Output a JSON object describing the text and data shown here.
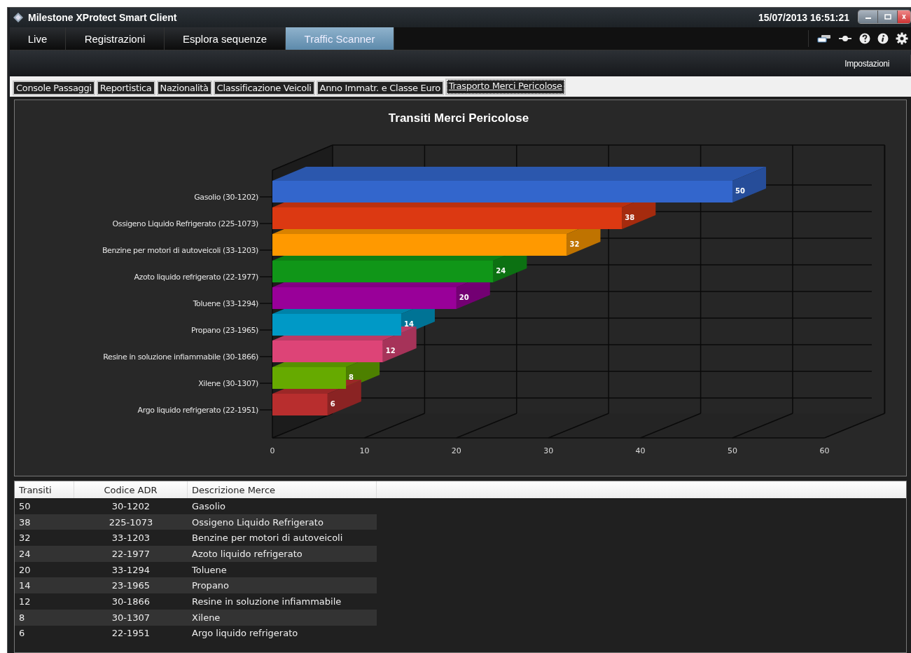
{
  "window": {
    "title": "Milestone XProtect Smart Client",
    "datetime": "15/07/2013 16:51:21"
  },
  "main_tabs": [
    {
      "label": "Live",
      "selected": false
    },
    {
      "label": "Registrazioni",
      "selected": false
    },
    {
      "label": "Esplora sequenze",
      "selected": false
    },
    {
      "label": "Traffic Scanner",
      "selected": true
    }
  ],
  "toolbar": {
    "settings_label": "Impostazioni"
  },
  "sub_tabs": [
    {
      "label": "Console Passaggi",
      "selected": false
    },
    {
      "label": "Reportistica",
      "selected": false
    },
    {
      "label": "Nazionalità",
      "selected": false
    },
    {
      "label": "Classificazione Veicoli",
      "selected": false
    },
    {
      "label": "Anno Immatr. e Classe Euro",
      "selected": false
    },
    {
      "label": "Trasporto Merci Pericolose",
      "selected": true
    }
  ],
  "chart": {
    "chart_data": {
      "type": "bar",
      "orientation": "horizontal",
      "title": "Transiti Merci Pericolose",
      "categories": [
        "Gasolio (30-1202)",
        "Ossigeno Liquido Refrigerato (225-1073)",
        "Benzine per motori di autoveicoli (33-1203)",
        "Azoto liquido refrigerato (22-1977)",
        "Toluene (33-1294)",
        "Propano (23-1965)",
        "Resine in soluzione infiammabile (30-1866)",
        "Xilene (30-1307)",
        "Argo liquido refrigerato (22-1951)"
      ],
      "values": [
        50,
        38,
        32,
        24,
        20,
        14,
        12,
        8,
        6
      ],
      "xlim": [
        0,
        60
      ],
      "xticks": [
        0,
        10,
        20,
        30,
        40,
        50,
        60
      ],
      "data_labels": true
    }
  },
  "table": {
    "columns": [
      "Transiti",
      "Codice ADR",
      "Descrizione Merce"
    ],
    "rows": [
      [
        "50",
        "30-1202",
        "Gasolio"
      ],
      [
        "38",
        "225-1073",
        "Ossigeno Liquido Refrigerato"
      ],
      [
        "32",
        "33-1203",
        "Benzine per motori di autoveicoli"
      ],
      [
        "24",
        "22-1977",
        "Azoto liquido refrigerato"
      ],
      [
        "20",
        "33-1294",
        "Toluene"
      ],
      [
        "14",
        "23-1965",
        "Propano"
      ],
      [
        "12",
        "30-1866",
        "Resine in soluzione infiammabile"
      ],
      [
        "8",
        "30-1307",
        "Xilene"
      ],
      [
        "6",
        "22-1951",
        "Argo liquido refrigerato"
      ]
    ]
  }
}
